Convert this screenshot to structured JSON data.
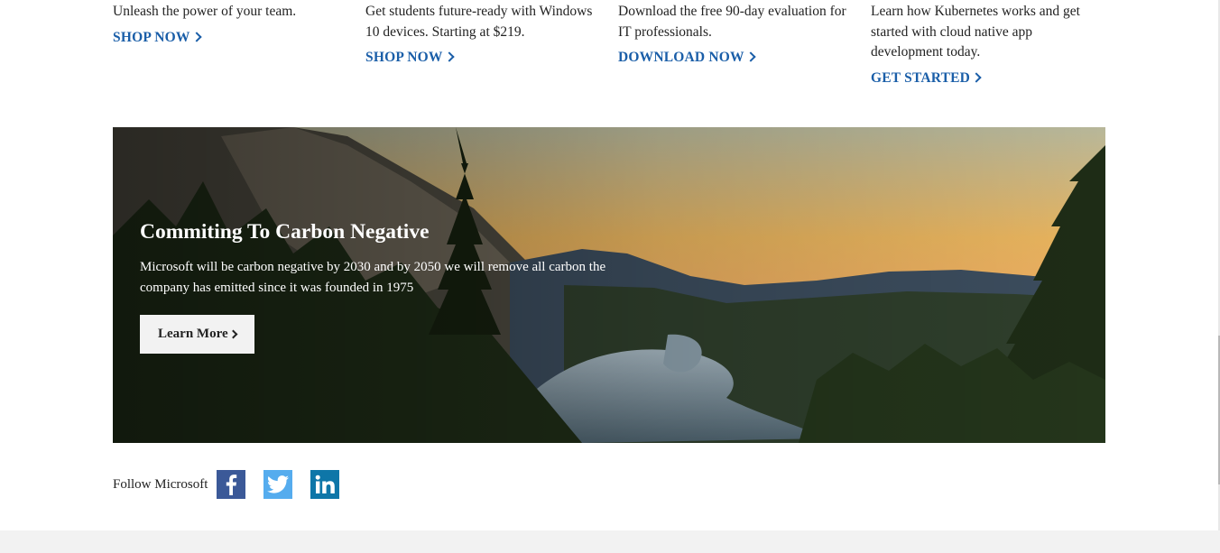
{
  "cards": [
    {
      "text": "Unleash the power of your team.",
      "cta": "SHOP NOW"
    },
    {
      "text": "Get students future-ready with Windows 10 devices. Starting at $219.",
      "cta": "SHOP NOW"
    },
    {
      "text": "Download the free 90-day evaluation for IT professionals.",
      "cta": "DOWNLOAD NOW"
    },
    {
      "text": "Learn how Kubernetes works and get started with cloud native app development today.",
      "cta": "GET STARTED"
    }
  ],
  "hero": {
    "title": "Commiting To Carbon Negative",
    "body": "Microsoft will be carbon negative by 2030 and by 2050 we will remove all carbon the company has emitted since it was founded in 1975",
    "button": "Learn More"
  },
  "follow": {
    "label": "Follow Microsoft",
    "networks": [
      "facebook-icon",
      "twitter-icon",
      "linkedin-icon"
    ]
  },
  "colors": {
    "link": "#1a5ea8",
    "facebook": "#3b5998",
    "twitter": "#55acee",
    "linkedin": "#0e76a8",
    "footer": "#f2f2f2"
  }
}
